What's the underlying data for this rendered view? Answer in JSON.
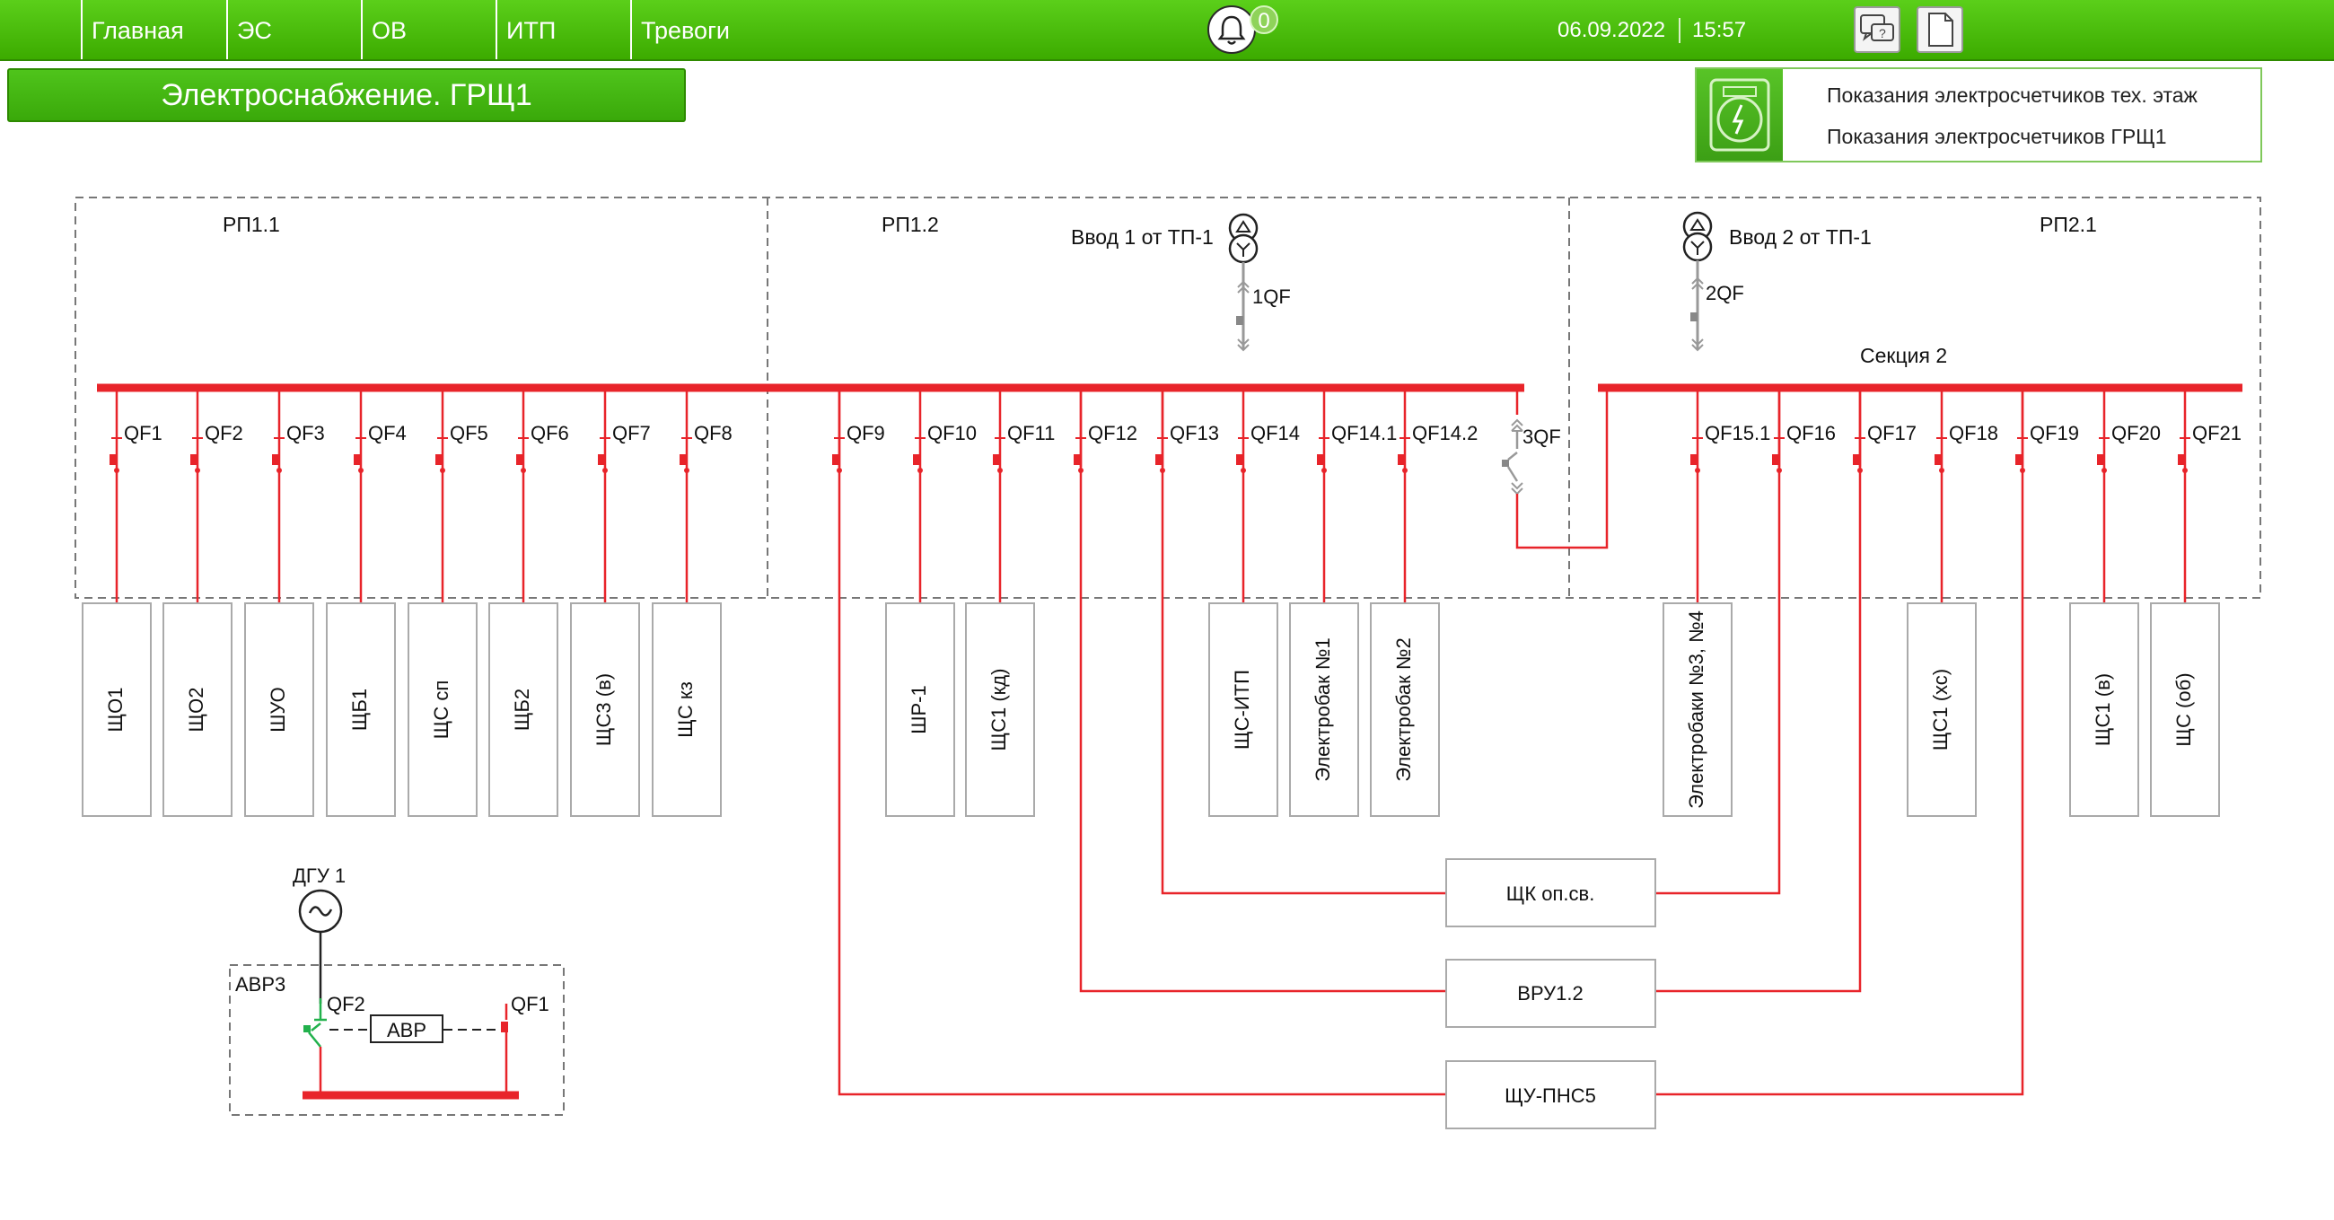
{
  "nav": {
    "items": [
      "Главная",
      "ЭС",
      "ОВ",
      "ИТП",
      "Тревоги"
    ],
    "alarm_count": "0",
    "date": "06.09.2022",
    "time": "15:57",
    "icons": [
      "bell-icon",
      "chat-help-icon",
      "document-icon"
    ]
  },
  "page_title": "Электроснабжение. ГРЩ1",
  "meter_panel": {
    "links": [
      "Показания электросчетчиков тех. этаж",
      "Показания электросчетчиков ГРЩ1"
    ]
  },
  "zones": {
    "rp11": "РП1.1",
    "rp12": "РП1.2",
    "rp21": "РП2.1"
  },
  "inputs": {
    "in1": "Ввод 1 от ТП-1",
    "in2": "Ввод 2 от ТП-1",
    "qf_in1": "1QF",
    "qf_in2": "2QF",
    "qf_tie": "3QF",
    "section2": "Секция 2"
  },
  "feeders": [
    {
      "breaker": "QF1",
      "load": "ЩО1"
    },
    {
      "breaker": "QF2",
      "load": "ЩО2"
    },
    {
      "breaker": "QF3",
      "load": "ШУО"
    },
    {
      "breaker": "QF4",
      "load": "ЩБ1"
    },
    {
      "breaker": "QF5",
      "load": "ЩС сп"
    },
    {
      "breaker": "QF6",
      "load": "ЩБ2"
    },
    {
      "breaker": "QF7",
      "load": "ЩС3 (в)"
    },
    {
      "breaker": "QF8",
      "load": "ЩС кз"
    },
    {
      "breaker": "QF9",
      "load": ""
    },
    {
      "breaker": "QF10",
      "load": "ШР-1"
    },
    {
      "breaker": "QF11",
      "load": "ЩС1 (кд)"
    },
    {
      "breaker": "QF12",
      "load": ""
    },
    {
      "breaker": "QF13",
      "load": ""
    },
    {
      "breaker": "QF14",
      "load": "ЩС-ИТП"
    },
    {
      "breaker": "QF14.1",
      "load": "Электробак №1"
    },
    {
      "breaker": "QF14.2",
      "load": "Электробак №2"
    },
    {
      "breaker": "QF15.1",
      "load": "Электробаки №3, №4"
    },
    {
      "breaker": "QF16",
      "load": ""
    },
    {
      "breaker": "QF17",
      "load": ""
    },
    {
      "breaker": "QF18",
      "load": "ЩС1 (хс)"
    },
    {
      "breaker": "QF19",
      "load": ""
    },
    {
      "breaker": "QF20",
      "load": "ЩС1 (в)"
    },
    {
      "breaker": "QF21",
      "load": "ЩС (об)"
    }
  ],
  "shared_loads": [
    "ЩК оп.св.",
    "ВРУ1.2",
    "ЩУ-ПНС5"
  ],
  "avr": {
    "generator": "ДГУ 1",
    "zone": "АВР3",
    "qf_gen": "QF2",
    "qf_net": "QF1",
    "block": "АВР"
  },
  "colors": {
    "bus_active": "#e8242a",
    "breaker_green": "#22b14c",
    "header_green": "#3cab00"
  }
}
